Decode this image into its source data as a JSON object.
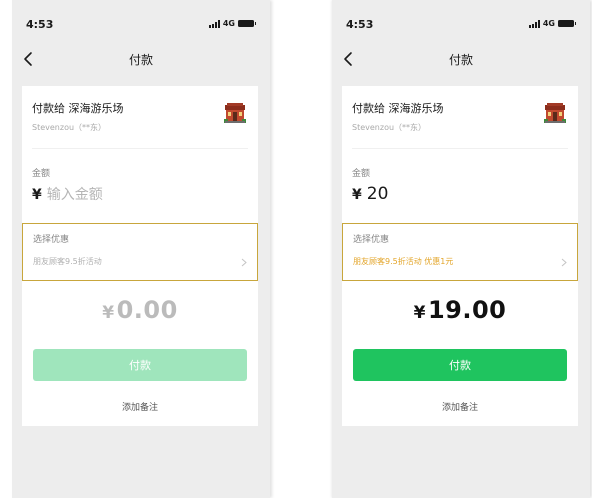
{
  "screens": [
    {
      "status": {
        "time": "4:53",
        "network": "4G"
      },
      "nav": {
        "title": "付款"
      },
      "payee": {
        "name": "付款给 深海游乐场",
        "sub": "Stevenzou（**东）"
      },
      "amount": {
        "label": "金额",
        "currency": "¥",
        "placeholder": "输入金额",
        "value": ""
      },
      "discount": {
        "title": "选择优惠",
        "option": "朋友顾客9.5折活动"
      },
      "total": {
        "currency": "¥",
        "value": "0.00"
      },
      "pay_button": {
        "label": "付款"
      },
      "remark": {
        "label": "添加备注"
      }
    },
    {
      "status": {
        "time": "4:53",
        "network": "4G"
      },
      "nav": {
        "title": "付款"
      },
      "payee": {
        "name": "付款给 深海游乐场",
        "sub": "Stevenzou（**东）"
      },
      "amount": {
        "label": "金额",
        "currency": "¥",
        "placeholder": "",
        "value": "20"
      },
      "discount": {
        "title": "选择优惠",
        "option": "朋友顾客9.5折活动  优惠1元"
      },
      "total": {
        "currency": "¥",
        "value": "19.00"
      },
      "pay_button": {
        "label": "付款"
      },
      "remark": {
        "label": "添加备注"
      }
    }
  ],
  "colors": {
    "accent_green": "#1fc45f",
    "disabled_green": "#9fe5bc",
    "highlight_border": "#c8a63c",
    "discount_gold": "#e3a52a"
  }
}
